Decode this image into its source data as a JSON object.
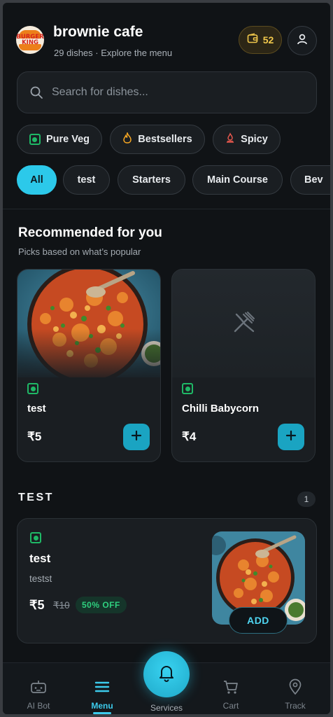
{
  "header": {
    "logo_text": "BURGER KING",
    "title": "brownie cafe",
    "subtitle": "29 dishes · Explore the menu",
    "wallet_value": "52"
  },
  "search": {
    "placeholder": "Search for dishes..."
  },
  "filters": [
    {
      "label": "Pure Veg",
      "icon": "veg-icon"
    },
    {
      "label": "Bestsellers",
      "icon": "flame-icon"
    },
    {
      "label": "Spicy",
      "icon": "chili-icon"
    }
  ],
  "categories": [
    {
      "label": "All",
      "active": true
    },
    {
      "label": "test"
    },
    {
      "label": "Starters"
    },
    {
      "label": "Main Course"
    },
    {
      "label": "Bev"
    }
  ],
  "recommended": {
    "title": "Recommended for you",
    "subtitle": "Picks based on what’s popular",
    "items": [
      {
        "name": "test",
        "price": "₹5",
        "image": "dish-photo",
        "veg": true
      },
      {
        "name": "Chilli Babycorn",
        "price": "₹4",
        "image": "fork-knife-placeholder-icon",
        "veg": true
      }
    ]
  },
  "section": {
    "title": "TEST",
    "count": "1",
    "item": {
      "name": "test",
      "description": "testst",
      "price": "₹5",
      "original_price": "₹10",
      "discount": "50% OFF",
      "add_label": "ADD",
      "veg": true
    }
  },
  "nav": {
    "items": [
      {
        "label": "AI Bot",
        "icon": "bot-icon"
      },
      {
        "label": "Menu",
        "icon": "menu-icon",
        "active": true
      },
      {
        "label": "Services",
        "icon": "bell-icon"
      },
      {
        "label": "Cart",
        "icon": "cart-icon"
      },
      {
        "label": "Track",
        "icon": "location-pin-icon"
      }
    ]
  },
  "colors": {
    "accent": "#2cc9ea",
    "background": "#101316",
    "veg": "#1fb866",
    "wallet": "#f2c94c"
  }
}
